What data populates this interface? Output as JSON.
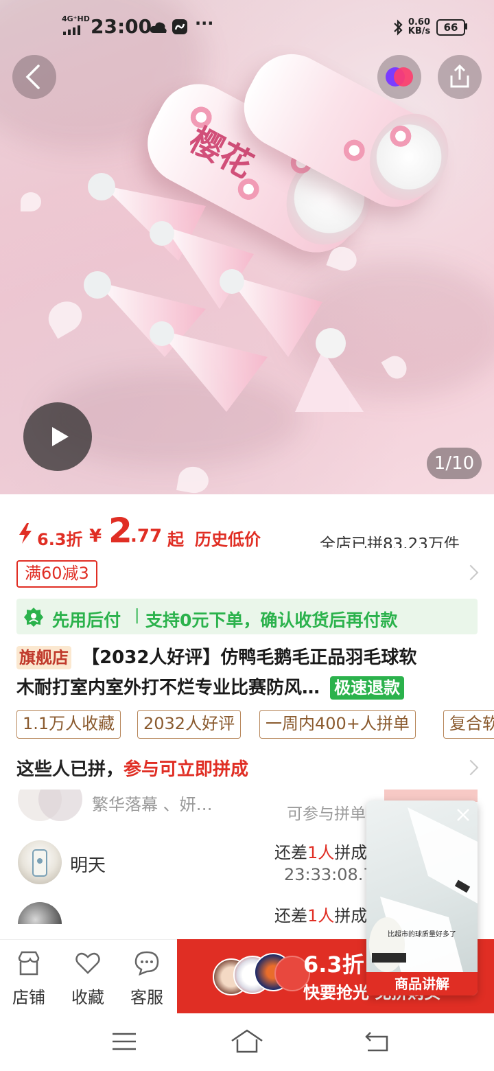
{
  "status_bar": {
    "network": "4G⁺HD",
    "time": "23:00",
    "more": "···",
    "speed_value": "0.60",
    "speed_unit": "KB/s",
    "battery": "66"
  },
  "hero": {
    "counter": "1/10",
    "product_text": "樱花"
  },
  "price": {
    "discount": "6.3折",
    "currency": "¥",
    "integer": "2",
    "decimal": ".77",
    "suffix": "起",
    "history_low": "历史低价",
    "store_sold": "全店已拼83.23万件"
  },
  "coupon": "满60减3",
  "pay_later": {
    "label": "先用后付",
    "divider": "|",
    "desc": "支持0元下单，确认收货后再付款"
  },
  "title": {
    "shop_badge": "旗舰店",
    "line1": "【2032人好评】仿鸭毛鹅毛正品羽毛球软",
    "line2": "木耐打室内室外打不烂专业比赛防风…",
    "refund_badge": "极速退款"
  },
  "tags": [
    "1.1万人收藏",
    "2032人好评",
    "一周内400+人拼单",
    "复合软"
  ],
  "group": {
    "heading_prefix": "这些人已拼，",
    "heading_highlight": "参与可立即拼成",
    "partial_name": "繁华落幕 、妍…",
    "partial_right": "可参与拼单",
    "rows": [
      {
        "name": "明天",
        "need_prefix": "还差",
        "need_count": "1人",
        "need_suffix": "拼成",
        "time": "23:33:08.7"
      },
      {
        "name": "",
        "need_prefix": "还差",
        "need_count": "1人",
        "need_suffix": "拼成",
        "time": ""
      }
    ]
  },
  "bottom_bar": {
    "shop": "店铺",
    "favorite": "收藏",
    "service": "客服",
    "buy_discount": "6.3折",
    "buy_sub": "快要抢光 免拼购买"
  },
  "pip": {
    "caption": "比超市的球质量好多了",
    "label": "商品讲解"
  },
  "colors": {
    "brand_red": "#e02e24",
    "tag_border": "#b7865a",
    "pay_later_bg": "#eaf6ea",
    "refund_green": "#2bb24c"
  }
}
